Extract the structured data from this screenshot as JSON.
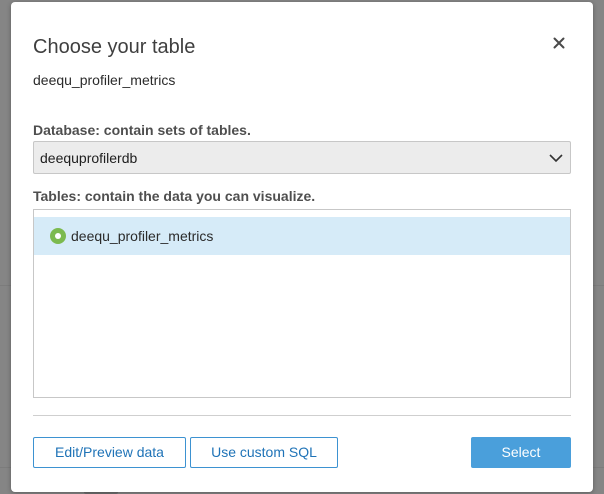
{
  "dialog": {
    "title": "Choose your table",
    "subtitle": "deequ_profiler_metrics",
    "close_icon": "close-icon"
  },
  "database": {
    "label": "Database: contain sets of tables.",
    "selected": "deequprofilerdb",
    "dropdown_icon": "chevron-down-icon"
  },
  "tables": {
    "label": "Tables: contain the data you can visualize.",
    "items": [
      {
        "label": "deequ_profiler_metrics",
        "selected": true
      }
    ]
  },
  "footer": {
    "edit_label": "Edit/Preview data",
    "sql_label": "Use custom SQL",
    "select_label": "Select"
  },
  "colors": {
    "accent": "#4a9fdb",
    "selected_row": "#d6ebf8",
    "radio_selected": "#7cba4f"
  }
}
